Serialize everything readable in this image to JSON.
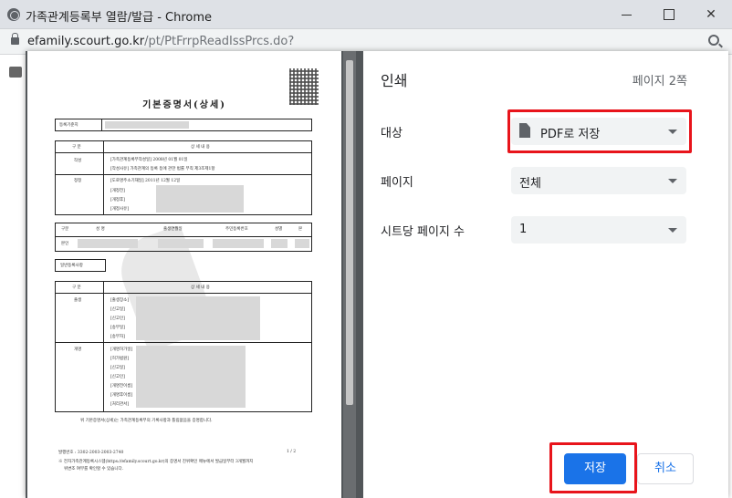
{
  "window": {
    "title": "가족관계등록부 열람/발급 - Chrome"
  },
  "address_bar": {
    "domain": "efamily.scourt.go.kr",
    "path": "/pt/PtFrrpReadIssPrcs.do?"
  },
  "icons": {
    "site": "globe-icon",
    "lock": "lock-icon",
    "zoom": "zoom-icon",
    "printer": "printer-icon",
    "file": "file-icon",
    "dropdown": "chevron-down-icon",
    "qr": "qr-code-icon"
  },
  "document": {
    "title": "기본증명서(상세)",
    "reg_base_label": "등록기준지",
    "section_header_left": "구 분",
    "section_header_right": "상 세 내 용",
    "row_create": "작성",
    "create_line1": "[가족관계등록부작성일]    2008년 01월 01일",
    "create_line2": "[작성사유]    가족관계의 등록 등에 관한 법률 부칙 제3조제1항",
    "row_change": "정정",
    "change_line1": "[도로명주소기재일]    2011년 12월 12일",
    "change_line2": "[개정전]",
    "change_line3": "[개정후]",
    "change_line4": "[개정사유]",
    "person_headers": [
      "구분",
      "성    명",
      "출생연월일",
      "주민등록번호",
      "성별",
      "본"
    ],
    "person_row_label": "본인",
    "general_label": "일반등록사항",
    "section2_header_left": "구 분",
    "section2_header_right": "상 세 내 용",
    "row_birth": "출생",
    "birth_lines": [
      "[출생장소]",
      "[신고일]",
      "[신고인]",
      "[송부일]",
      "[송부자]"
    ],
    "row_rename": "개명",
    "rename_lines": [
      "[개명허가일]",
      "[허가법원]",
      "[신고일]",
      "[신고인]",
      "[개명전이름]",
      "[개명후이름]",
      "[처리관서]"
    ],
    "certify_text": "위 기본증명서(상세)는 가족관계등록부의 기록사항과 틀림없음을 증명합니다.",
    "issue_no": "발행번호 : 3302-2003-2003-2740",
    "page_no": "1 / 2",
    "footnote_1": "※ 전자가족관계등록시스템(https://efamily.scourt.go.kr)의 증명서 진위확인 메뉴에서 발급일부터 3개월까지",
    "footnote_2": "위변조 여부를 확인할 수 있습니다."
  },
  "print_panel": {
    "title": "인쇄",
    "page_count": "페이지 2쪽",
    "destination_label": "대상",
    "destination_value": "PDF로 저장",
    "pages_label": "페이지",
    "pages_value": "전체",
    "pages_per_sheet_label": "시트당 페이지 수",
    "pages_per_sheet_value": "1",
    "save_button": "저장",
    "cancel_button": "취소"
  },
  "colors": {
    "highlight": "#e8141b",
    "primary": "#1a73e8",
    "preview_bg": "#525659"
  }
}
